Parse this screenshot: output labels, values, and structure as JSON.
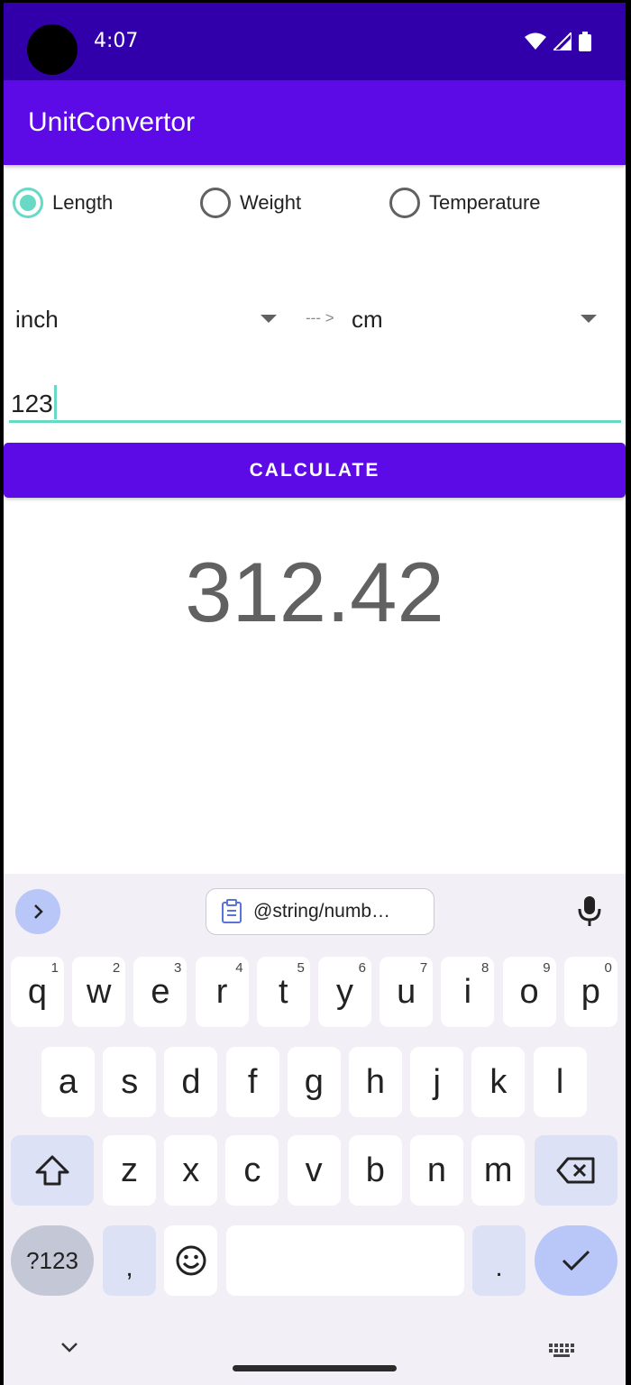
{
  "status_bar": {
    "time": "4:07"
  },
  "app_bar": {
    "title": "UnitConvertor"
  },
  "radio_group": [
    {
      "label": "Length",
      "checked": true
    },
    {
      "label": "Weight",
      "checked": false
    },
    {
      "label": "Temperature",
      "checked": false
    }
  ],
  "converter": {
    "from_unit": "inch",
    "arrow": "--- >",
    "to_unit": "cm",
    "input_value": "123",
    "calculate_label": "CALCULATE",
    "result": "312.42"
  },
  "keyboard": {
    "clipboard_chip": "@string/numb…",
    "rows": [
      [
        {
          "k": "q",
          "h": "1"
        },
        {
          "k": "w",
          "h": "2"
        },
        {
          "k": "e",
          "h": "3"
        },
        {
          "k": "r",
          "h": "4"
        },
        {
          "k": "t",
          "h": "5"
        },
        {
          "k": "y",
          "h": "6"
        },
        {
          "k": "u",
          "h": "7"
        },
        {
          "k": "i",
          "h": "8"
        },
        {
          "k": "o",
          "h": "9"
        },
        {
          "k": "p",
          "h": "0"
        }
      ],
      [
        {
          "k": "a"
        },
        {
          "k": "s"
        },
        {
          "k": "d"
        },
        {
          "k": "f"
        },
        {
          "k": "g"
        },
        {
          "k": "h"
        },
        {
          "k": "j"
        },
        {
          "k": "k"
        },
        {
          "k": "l"
        }
      ],
      [
        {
          "k": "z"
        },
        {
          "k": "x"
        },
        {
          "k": "c"
        },
        {
          "k": "v"
        },
        {
          "k": "b"
        },
        {
          "k": "n"
        },
        {
          "k": "m"
        }
      ]
    ],
    "symbols_label": "?123",
    "comma": ",",
    "period": "."
  },
  "colors": {
    "status_bar": "#3200aa",
    "primary": "#5c0be6",
    "accent": "#67d9c5"
  },
  "icons": [
    "wifi-icon",
    "signal-icon",
    "battery-icon",
    "chevron-right-icon",
    "clipboard-icon",
    "mic-icon",
    "shift-icon",
    "backspace-icon",
    "emoji-icon",
    "check-icon",
    "chevron-down-icon",
    "keyboard-icon"
  ]
}
